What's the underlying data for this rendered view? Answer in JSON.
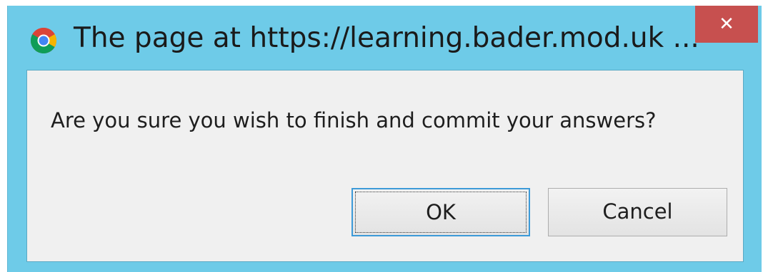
{
  "dialog": {
    "title": "The page at https://learning.bader.mod.uk ...",
    "app_icon": "chrome-icon",
    "close_label": "✕",
    "message": "Are you sure you wish to finish and commit your answers?",
    "ok_label": "OK",
    "cancel_label": "Cancel",
    "focused_button": "OK"
  },
  "colors": {
    "title_bar": "#6ecbe8",
    "close_button": "#c7504f",
    "client_background": "#f0f0f0",
    "focus_border": "#3c9ad8"
  }
}
